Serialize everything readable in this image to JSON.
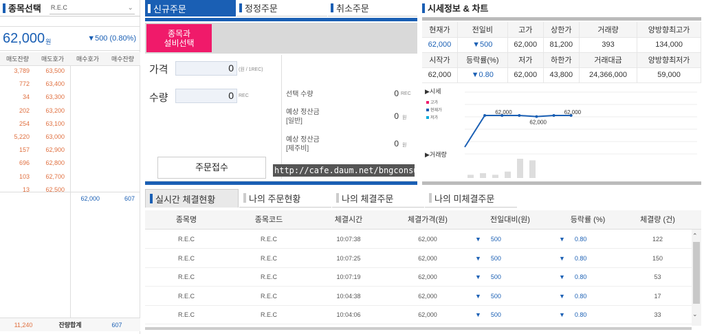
{
  "left": {
    "title": "종목선택",
    "select_value": "R.E.C",
    "price": "62,000",
    "price_unit": "원",
    "change": "▼500 (0.80%)",
    "orderbook_head": [
      "매도잔량",
      "매도호가",
      "매수호가",
      "매수잔량"
    ],
    "sell_rows": [
      [
        "3,789",
        "63,500"
      ],
      [
        "772",
        "63,400"
      ],
      [
        "34",
        "63,300"
      ],
      [
        "202",
        "63,200"
      ],
      [
        "254",
        "63,100"
      ],
      [
        "5,220",
        "63,000"
      ],
      [
        "157",
        "62,900"
      ],
      [
        "696",
        "62,800"
      ],
      [
        "103",
        "62,700"
      ],
      [
        "13",
        "62,500"
      ]
    ],
    "buy_row": [
      "62,000",
      "607"
    ],
    "foot": [
      "11,240",
      "잔량합계",
      "607"
    ]
  },
  "tabs": [
    "신규주문",
    "정정주문",
    "취소주문"
  ],
  "order": {
    "pink_line1": "종목과",
    "pink_line2": "설비선택",
    "price_label": "가격",
    "price_value": "0",
    "price_unit": "(원 / 1REC)",
    "qty_label": "수량",
    "qty_value": "0",
    "qty_unit": "REC",
    "sel_qty_label": "선택 수량",
    "sel_qty_value": "0",
    "sel_qty_unit": "REC",
    "est1_label1": "예상 정산금",
    "est1_label2": "[일반]",
    "est1_value": "0",
    "est1_unit": "원",
    "est2_label1": "예상 정산금",
    "est2_label2": "[제주비]",
    "est2_value": "0",
    "est2_unit": "원",
    "submit": "주문접수",
    "watermark": "http://cafe.daum.net/bngconsulting"
  },
  "quote": {
    "title": "시세정보 & 차트",
    "head1": [
      "현재가",
      "전일비",
      "고가",
      "상한가",
      "거래량",
      "양방향최고가"
    ],
    "row1": [
      "62,000",
      "▼500",
      "62,000",
      "81,200",
      "393",
      "134,000"
    ],
    "head2": [
      "시작가",
      "등락률(%)",
      "저가",
      "하한가",
      "거래대금",
      "양방향최저가"
    ],
    "row2": [
      "62,000",
      "▼0.80",
      "62,000",
      "43,800",
      "24,366,000",
      "59,000"
    ]
  },
  "chart_data": {
    "type": "line",
    "title": "",
    "section_price": "▶시세",
    "section_volume": "▶거래량",
    "legend": [
      "고가",
      "현재가",
      "저가"
    ],
    "legend_colors": [
      "#f01a6a",
      "#1a5fb4",
      "#00aadd"
    ],
    "x": [
      0,
      1,
      2,
      3,
      4,
      5,
      6
    ],
    "series": [
      {
        "name": "현재가",
        "values": [
          0,
          62000,
          62000,
          62000,
          61900,
          62000,
          62000
        ]
      }
    ],
    "point_labels": [
      {
        "index": 2,
        "text": "62,000"
      },
      {
        "index": 4,
        "text": "62,000"
      },
      {
        "index": 6,
        "text": "62,000"
      }
    ],
    "volume_bars": [
      2,
      3,
      2,
      4,
      12,
      11,
      0
    ]
  },
  "bottom": {
    "tabs": [
      "실시간 체결현황",
      "나의 주문현황",
      "나의 체결주문",
      "나의 미체결주문"
    ],
    "head": [
      "종목명",
      "종목코드",
      "체결시간",
      "체결가격(원)",
      "전일대비(원)",
      "등락률 (%)",
      "체결량 (건)"
    ],
    "rows": [
      [
        "R.E.C",
        "R.E.C",
        "10:07:38",
        "62,000",
        "500",
        "0.80",
        "122"
      ],
      [
        "R.E.C",
        "R.E.C",
        "10:07:25",
        "62,000",
        "500",
        "0.80",
        "150"
      ],
      [
        "R.E.C",
        "R.E.C",
        "10:07:19",
        "62,000",
        "500",
        "0.80",
        "53"
      ],
      [
        "R.E.C",
        "R.E.C",
        "10:04:38",
        "62,000",
        "500",
        "0.80",
        "17"
      ],
      [
        "R.E.C",
        "R.E.C",
        "10:04:06",
        "62,000",
        "500",
        "0.80",
        "33"
      ]
    ]
  }
}
